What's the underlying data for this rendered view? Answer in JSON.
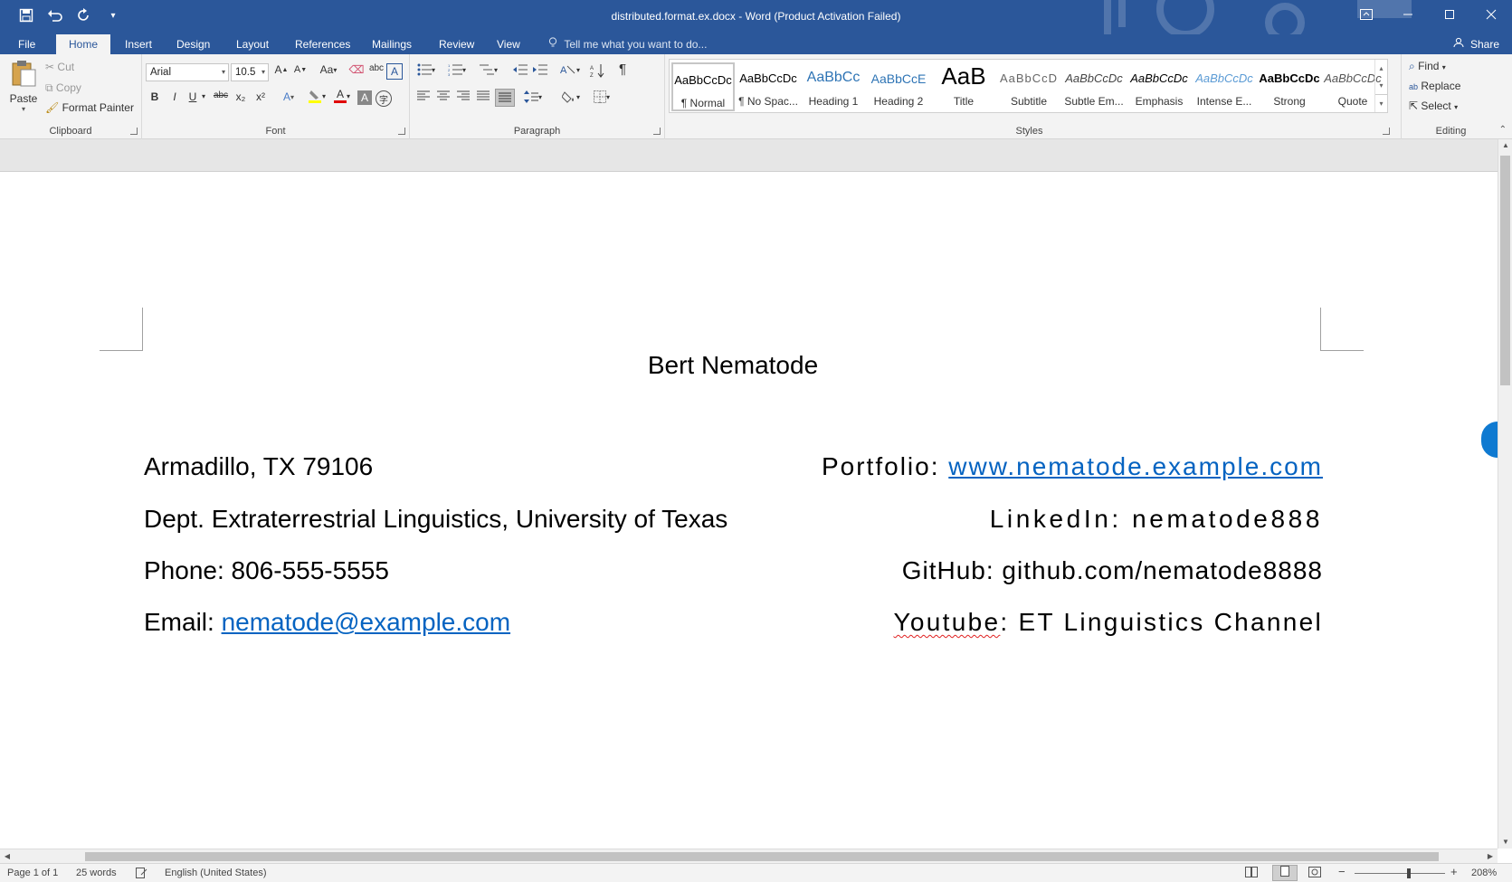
{
  "window": {
    "title": "distributed.format.ex.docx - Word (Product Activation Failed)",
    "controls": [
      "ribbon-display-options",
      "minimize",
      "maximize",
      "close"
    ]
  },
  "quick_access": [
    "save-icon",
    "undo-icon",
    "redo-icon",
    "customize-icon"
  ],
  "tabs": {
    "file": "File",
    "home": "Home",
    "insert": "Insert",
    "design": "Design",
    "layout": "Layout",
    "references": "References",
    "mailings": "Mailings",
    "review": "Review",
    "view": "View",
    "tell_me": "Tell me what you want to do...",
    "share": "Share"
  },
  "clipboard": {
    "paste": "Paste",
    "cut": "Cut",
    "copy": "Copy",
    "format_painter": "Format Painter",
    "label": "Clipboard"
  },
  "font": {
    "name": "Arial",
    "size": "10.5",
    "label": "Font",
    "change_case": "Aa",
    "bold": "B",
    "italic": "I",
    "underline": "U",
    "strikethrough": "abc",
    "subscript": "x₂",
    "superscript": "x²"
  },
  "paragraph": {
    "label": "Paragraph"
  },
  "styles": {
    "label": "Styles",
    "items": [
      {
        "sample": "AaBbCcDc",
        "name": "¶ Normal"
      },
      {
        "sample": "AaBbCcDc",
        "name": "¶ No Spac..."
      },
      {
        "sample": "AaBbCc",
        "name": "Heading 1"
      },
      {
        "sample": "AaBbCcE",
        "name": "Heading 2"
      },
      {
        "sample": "AaB",
        "name": "Title"
      },
      {
        "sample": "AaBbCcD",
        "name": "Subtitle"
      },
      {
        "sample": "AaBbCcDc",
        "name": "Subtle Em..."
      },
      {
        "sample": "AaBbCcDc",
        "name": "Emphasis"
      },
      {
        "sample": "AaBbCcDc",
        "name": "Intense E..."
      },
      {
        "sample": "AaBbCcDc",
        "name": "Strong"
      },
      {
        "sample": "AaBbCcDc",
        "name": "Quote"
      }
    ]
  },
  "editing": {
    "find": "Find",
    "replace": "Replace",
    "select": "Select",
    "label": "Editing"
  },
  "document": {
    "title": "Bert Nematode",
    "left": {
      "address": "Armadillo, TX 79106",
      "dept": "Dept. Extraterrestrial Linguistics, University of Texas",
      "phone": "Phone: 806-555-5555",
      "email_label": "Email: ",
      "email": "nematode@example.com"
    },
    "right": {
      "portfolio_label": "Portfolio: ",
      "portfolio_url": "www.nematode.example.com",
      "linkedin": "LinkedIn: nematode888",
      "github": "GitHub: github.com/nematode8888",
      "youtube_word": "Youtube",
      "youtube_rest": ": ET Linguistics Channel"
    }
  },
  "status": {
    "page": "Page 1 of 1",
    "words": "25 words",
    "language": "English (United States)",
    "zoom": "208%",
    "zoom_fraction": 0.6
  },
  "colors": {
    "accent": "#2b579a",
    "link": "#0563c1"
  }
}
